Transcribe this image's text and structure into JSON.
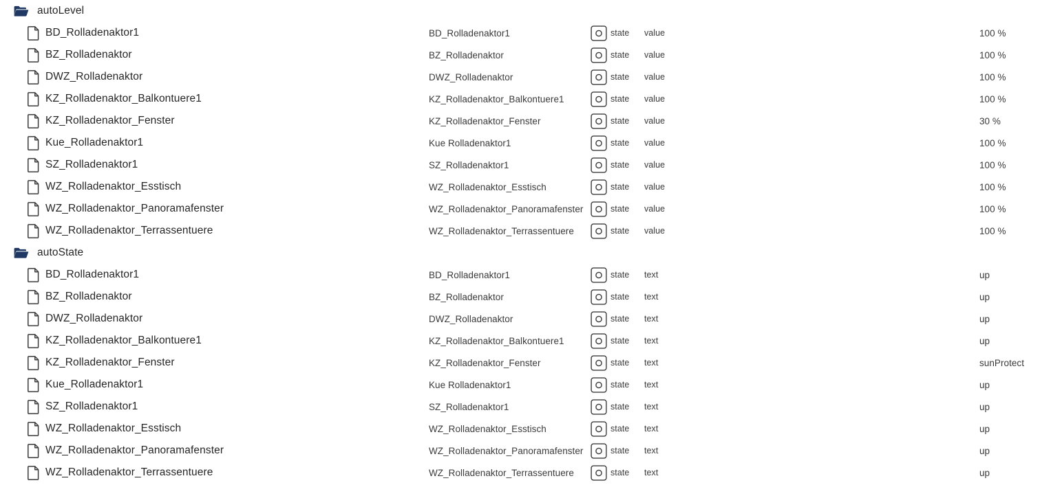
{
  "groups": [
    {
      "icon": "folder-open-icon",
      "label": "autoLevel",
      "type_label": "value",
      "state_label": "state",
      "badge_icon": "state-circle-icon",
      "file_icon": "file-document-icon",
      "items": [
        {
          "name": "BD_Rolladenaktor1",
          "desc": "BD_Rolladenaktor1",
          "state": "state",
          "type": "value",
          "value": "100 %"
        },
        {
          "name": "BZ_Rolladenaktor",
          "desc": "BZ_Rolladenaktor",
          "state": "state",
          "type": "value",
          "value": "100 %"
        },
        {
          "name": "DWZ_Rolladenaktor",
          "desc": "DWZ_Rolladenaktor",
          "state": "state",
          "type": "value",
          "value": "100 %"
        },
        {
          "name": "KZ_Rolladenaktor_Balkontuere1",
          "desc": "KZ_Rolladenaktor_Balkontuere1",
          "state": "state",
          "type": "value",
          "value": "100 %"
        },
        {
          "name": "KZ_Rolladenaktor_Fenster",
          "desc": "KZ_Rolladenaktor_Fenster",
          "state": "state",
          "type": "value",
          "value": "30 %"
        },
        {
          "name": "Kue_Rolladenaktor1",
          "desc": "Kue Rolladenaktor1",
          "state": "state",
          "type": "value",
          "value": "100 %"
        },
        {
          "name": "SZ_Rolladenaktor1",
          "desc": "SZ_Rolladenaktor1",
          "state": "state",
          "type": "value",
          "value": "100 %"
        },
        {
          "name": "WZ_Rolladenaktor_Esstisch",
          "desc": "WZ_Rolladenaktor_Esstisch",
          "state": "state",
          "type": "value",
          "value": "100 %"
        },
        {
          "name": "WZ_Rolladenaktor_Panoramafenster",
          "desc": "WZ_Rolladenaktor_Panoramafenster",
          "state": "state",
          "type": "value",
          "value": "100 %"
        },
        {
          "name": "WZ_Rolladenaktor_Terrassentuere",
          "desc": "WZ_Rolladenaktor_Terrassentuere",
          "state": "state",
          "type": "value",
          "value": "100 %"
        }
      ]
    },
    {
      "icon": "folder-open-icon",
      "label": "autoState",
      "type_label": "text",
      "state_label": "state",
      "badge_icon": "state-circle-icon",
      "file_icon": "file-document-icon",
      "items": [
        {
          "name": "BD_Rolladenaktor1",
          "desc": "BD_Rolladenaktor1",
          "state": "state",
          "type": "text",
          "value": "up"
        },
        {
          "name": "BZ_Rolladenaktor",
          "desc": "BZ_Rolladenaktor",
          "state": "state",
          "type": "text",
          "value": "up"
        },
        {
          "name": "DWZ_Rolladenaktor",
          "desc": "DWZ_Rolladenaktor",
          "state": "state",
          "type": "text",
          "value": "up"
        },
        {
          "name": "KZ_Rolladenaktor_Balkontuere1",
          "desc": "KZ_Rolladenaktor_Balkontuere1",
          "state": "state",
          "type": "text",
          "value": "up"
        },
        {
          "name": "KZ_Rolladenaktor_Fenster",
          "desc": "KZ_Rolladenaktor_Fenster",
          "state": "state",
          "type": "text",
          "value": "sunProtect"
        },
        {
          "name": "Kue_Rolladenaktor1",
          "desc": "Kue Rolladenaktor1",
          "state": "state",
          "type": "text",
          "value": "up"
        },
        {
          "name": "SZ_Rolladenaktor1",
          "desc": "SZ_Rolladenaktor1",
          "state": "state",
          "type": "text",
          "value": "up"
        },
        {
          "name": "WZ_Rolladenaktor_Esstisch",
          "desc": "WZ_Rolladenaktor_Esstisch",
          "state": "state",
          "type": "text",
          "value": "up"
        },
        {
          "name": "WZ_Rolladenaktor_Panoramafenster",
          "desc": "WZ_Rolladenaktor_Panoramafenster",
          "state": "state",
          "type": "text",
          "value": "up"
        },
        {
          "name": "WZ_Rolladenaktor_Terrassentuere",
          "desc": "WZ_Rolladenaktor_Terrassentuere",
          "state": "state",
          "type": "text",
          "value": "up"
        }
      ]
    }
  ],
  "colors": {
    "folder": "#1F3864",
    "icon_outline": "#3A3A3A",
    "text": "#262626",
    "background": "#FFFFFF"
  }
}
